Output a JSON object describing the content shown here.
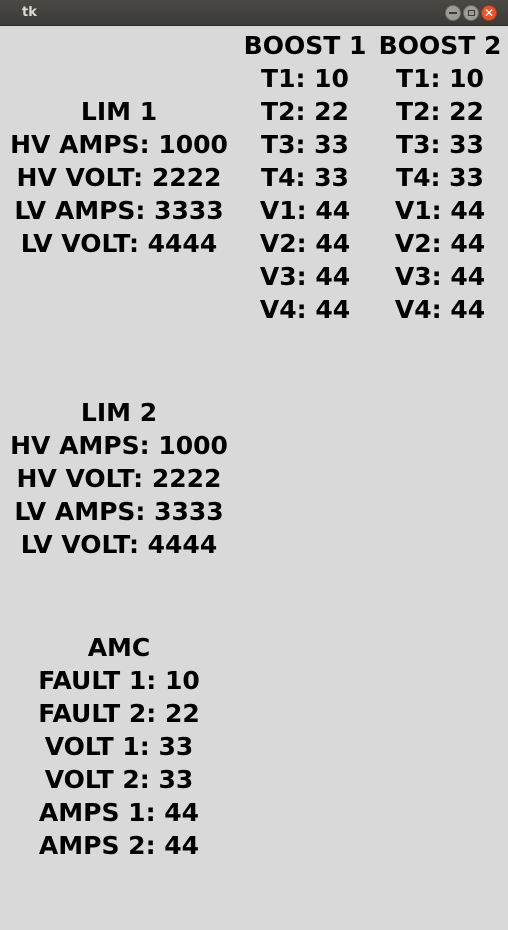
{
  "window": {
    "title": "tk"
  },
  "lim1": {
    "title": "LIM 1",
    "rows": [
      "HV AMPS: 1000",
      "HV VOLT: 2222",
      "LV AMPS: 3333",
      "LV VOLT: 4444"
    ]
  },
  "boost1": {
    "title": "BOOST 1",
    "rows": [
      "T1: 10",
      "T2: 22",
      "T3: 33",
      "T4: 33",
      "V1: 44",
      "V2: 44",
      "V3: 44",
      "V4: 44"
    ]
  },
  "boost2": {
    "title": "BOOST 2",
    "rows": [
      "T1: 10",
      "T2: 22",
      "T3: 33",
      "T4: 33",
      "V1: 44",
      "V2: 44",
      "V3: 44",
      "V4: 44"
    ]
  },
  "lim2": {
    "title": "LIM 2",
    "rows": [
      "HV AMPS: 1000",
      "HV VOLT: 2222",
      "LV AMPS: 3333",
      "LV VOLT: 4444"
    ]
  },
  "amc": {
    "title": "AMC",
    "rows": [
      "FAULT 1: 10",
      "FAULT 2: 22",
      "VOLT 1: 33",
      "VOLT 2: 33",
      "AMPS 1: 44",
      "AMPS 2: 44"
    ]
  },
  "icons": {
    "minimize": "minimize-icon",
    "maximize": "maximize-icon",
    "close": "close-icon"
  }
}
